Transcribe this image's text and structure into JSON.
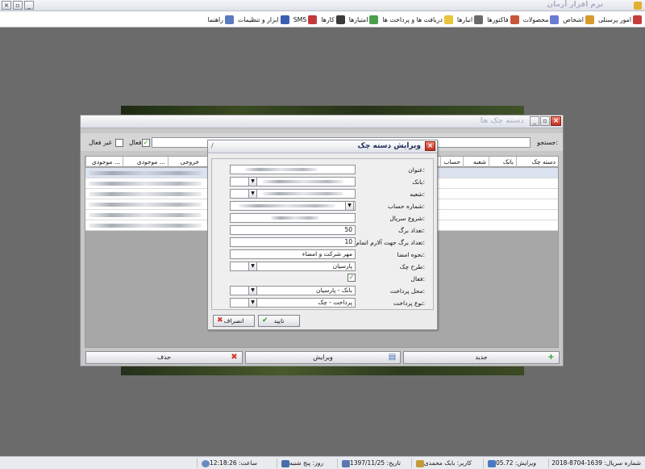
{
  "app": {
    "title": "نرم افزار آرمان"
  },
  "menu": [
    {
      "label": "امور پرسنلی",
      "icon": "personnel-icon",
      "color": "#c53c3c"
    },
    {
      "label": "اشخاص",
      "icon": "people-icon",
      "color": "#d79a2b"
    },
    {
      "label": "محصولات",
      "icon": "products-icon",
      "color": "#6a7bd4"
    },
    {
      "label": "فاکتورها",
      "icon": "invoices-icon",
      "color": "#c8563a"
    },
    {
      "label": "انبارها",
      "icon": "warehouse-icon",
      "color": "#6a6a6a"
    },
    {
      "label": "دریافت ها و پرداخت ها",
      "icon": "payments-icon",
      "color": "#e8c33c"
    },
    {
      "label": "امتیازها",
      "icon": "points-icon",
      "color": "#4aa04a"
    },
    {
      "label": "کارها",
      "icon": "tasks-icon",
      "color": "#3a3a3a"
    },
    {
      "label": "SMS",
      "icon": "sms-icon",
      "color": "#c23a3a"
    },
    {
      "label": "ابزار و تنظیمات",
      "icon": "tools-icon",
      "color": "#3a5fb0"
    },
    {
      "label": "راهنما",
      "icon": "help-icon",
      "color": "#5a7ac0"
    }
  ],
  "list_window": {
    "title": "دسته چک ها",
    "search_label": "جستجو:",
    "active_label": "فعال",
    "active_checked": true,
    "inactive_label": "غیر فعال",
    "inactive_checked": false,
    "columns": [
      "دسته چک",
      "بانک",
      "شعبه",
      "حساب",
      "خروجی",
      "موجودی ...",
      "موجودی ..."
    ],
    "buttons": {
      "new": "جدید",
      "edit": "ویرایش",
      "delete": "حذف"
    }
  },
  "dialog": {
    "title": "ویرایش دسته چک",
    "fields": [
      {
        "label": "عنوان:",
        "value": "",
        "type": "text"
      },
      {
        "label": "بانک:",
        "value": "",
        "type": "select"
      },
      {
        "label": "شعبه:",
        "value": "",
        "type": "select"
      },
      {
        "label": "شماره حساب:",
        "value": "",
        "type": "select"
      },
      {
        "label": "شروع سریال:",
        "value": "",
        "type": "text"
      },
      {
        "label": "تعداد برگ:",
        "value": "50",
        "type": "number"
      },
      {
        "label": "تعداد برگ جهت آلارم اتمام:",
        "value": "10",
        "type": "number"
      },
      {
        "label": "نحوه امضا:",
        "value": "مهر شرکت و امضاء",
        "type": "text"
      },
      {
        "label": "طرح چک:",
        "value": "پارسیان",
        "type": "select"
      },
      {
        "label": "فعال:",
        "value": "",
        "type": "checkbox",
        "checked": true
      },
      {
        "label": "محل پرداخت:",
        "value": "بانک - پارسیان",
        "type": "select"
      },
      {
        "label": "نوع پرداخت:",
        "value": "پرداخت - چک",
        "type": "select"
      }
    ],
    "ok_label": "تایید",
    "cancel_label": "انصراف"
  },
  "status": {
    "serial": "شماره سریال: 1639-8704-2018",
    "version": "ویرایش: 05.72",
    "user": "کاربر: بابک محمدی",
    "date": "تاریخ: 1397/11/25",
    "day": "روز: پنج شنبه",
    "time": "ساعت: 12:18:26"
  }
}
